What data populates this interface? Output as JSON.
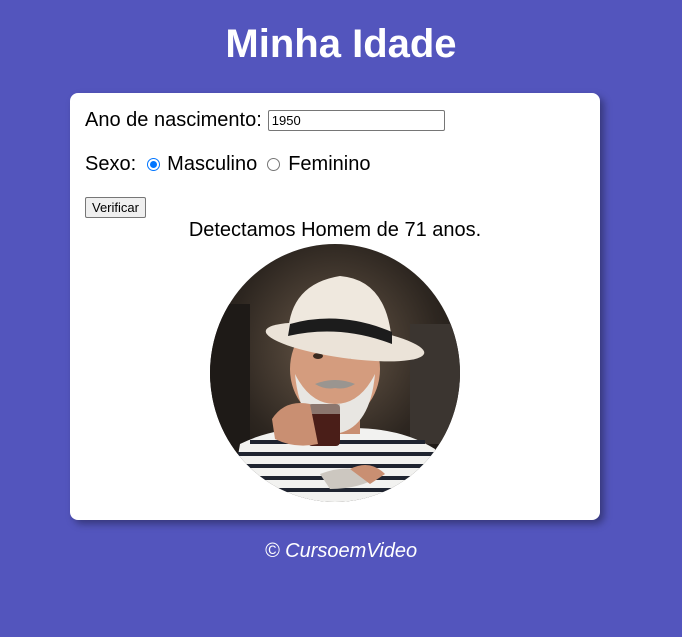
{
  "header": {
    "title": "Minha Idade"
  },
  "form": {
    "year_label": "Ano de nascimento:",
    "year_value": "1950",
    "sex_label": "Sexo:",
    "options": [
      {
        "label": "Masculino",
        "checked": true
      },
      {
        "label": "Feminino",
        "checked": false
      }
    ],
    "button_label": "Verificar"
  },
  "result": {
    "message": "Detectamos Homem de 71 anos."
  },
  "footer": {
    "text": "© CursoemVideo"
  },
  "colors": {
    "background": "#5355bd",
    "card": "#ffffff",
    "radio_accent": "#0075ff"
  }
}
